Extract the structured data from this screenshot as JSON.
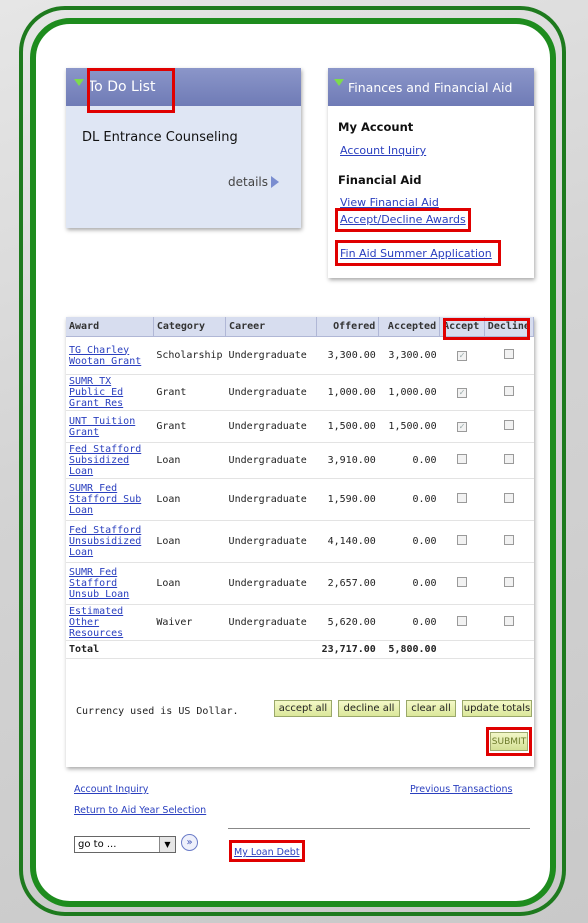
{
  "todo": {
    "title": "To Do List",
    "item": "DL Entrance Counseling",
    "details": "details"
  },
  "finances": {
    "title": "Finances and Financial Aid",
    "my_account_heading": "My Account",
    "account_inquiry": "Account Inquiry",
    "financial_aid_heading": "Financial Aid",
    "view_financial_aid": "View Financial Aid",
    "accept_decline": "Accept/Decline Awards",
    "summer_app": "Fin Aid Summer Application"
  },
  "awards": {
    "headers": [
      "Award",
      "Category",
      "Career",
      "Offered",
      "Accepted",
      "Accept",
      "Decline"
    ],
    "rows": [
      {
        "award": "TG Charley Wootan Grant",
        "category": "Scholarship",
        "career": "Undergraduate",
        "offered": "3,300.00",
        "accepted": "3,300.00",
        "accept_checked": true
      },
      {
        "award": "SUMR TX Public Ed Grant Res",
        "category": "Grant",
        "career": "Undergraduate",
        "offered": "1,000.00",
        "accepted": "1,000.00",
        "accept_checked": true
      },
      {
        "award": "UNT Tuition Grant",
        "category": "Grant",
        "career": "Undergraduate",
        "offered": "1,500.00",
        "accepted": "1,500.00",
        "accept_checked": true
      },
      {
        "award": "Fed Stafford Subsidized Loan",
        "category": "Loan",
        "career": "Undergraduate",
        "offered": "3,910.00",
        "accepted": "0.00",
        "accept_checked": false
      },
      {
        "award": "SUMR Fed Stafford Sub Loan",
        "category": "Loan",
        "career": "Undergraduate",
        "offered": "1,590.00",
        "accepted": "0.00",
        "accept_checked": false
      },
      {
        "award": "Fed Stafford Unsubsidized Loan",
        "category": "Loan",
        "career": "Undergraduate",
        "offered": "4,140.00",
        "accepted": "0.00",
        "accept_checked": false
      },
      {
        "award": "SUMR Fed Stafford Unsub Loan",
        "category": "Loan",
        "career": "Undergraduate",
        "offered": "2,657.00",
        "accepted": "0.00",
        "accept_checked": false
      },
      {
        "award": "Estimated Other Resources",
        "category": "Waiver",
        "career": "Undergraduate",
        "offered": "5,620.00",
        "accepted": "0.00",
        "accept_checked": false
      }
    ],
    "total_label": "Total",
    "total_offered": "23,717.00",
    "total_accepted": "5,800.00",
    "currency_note": "Currency used is US Dollar.",
    "buttons": {
      "accept_all": "accept all",
      "decline_all": "decline all",
      "clear_all": "clear all",
      "update_totals": "update totals",
      "submit": "SUBMIT"
    }
  },
  "footer": {
    "account_inquiry": "Account Inquiry",
    "return_link": "Return to Aid Year Selection",
    "previous_transactions": "Previous Transactions",
    "goto": "go to ...",
    "my_loan_debt": "My Loan Debt"
  },
  "colors": {
    "frame_green": "#1e8c1e",
    "highlight_red": "#e00000",
    "panel_header": "#6f7bb6",
    "link_blue": "#2a3fbf"
  }
}
